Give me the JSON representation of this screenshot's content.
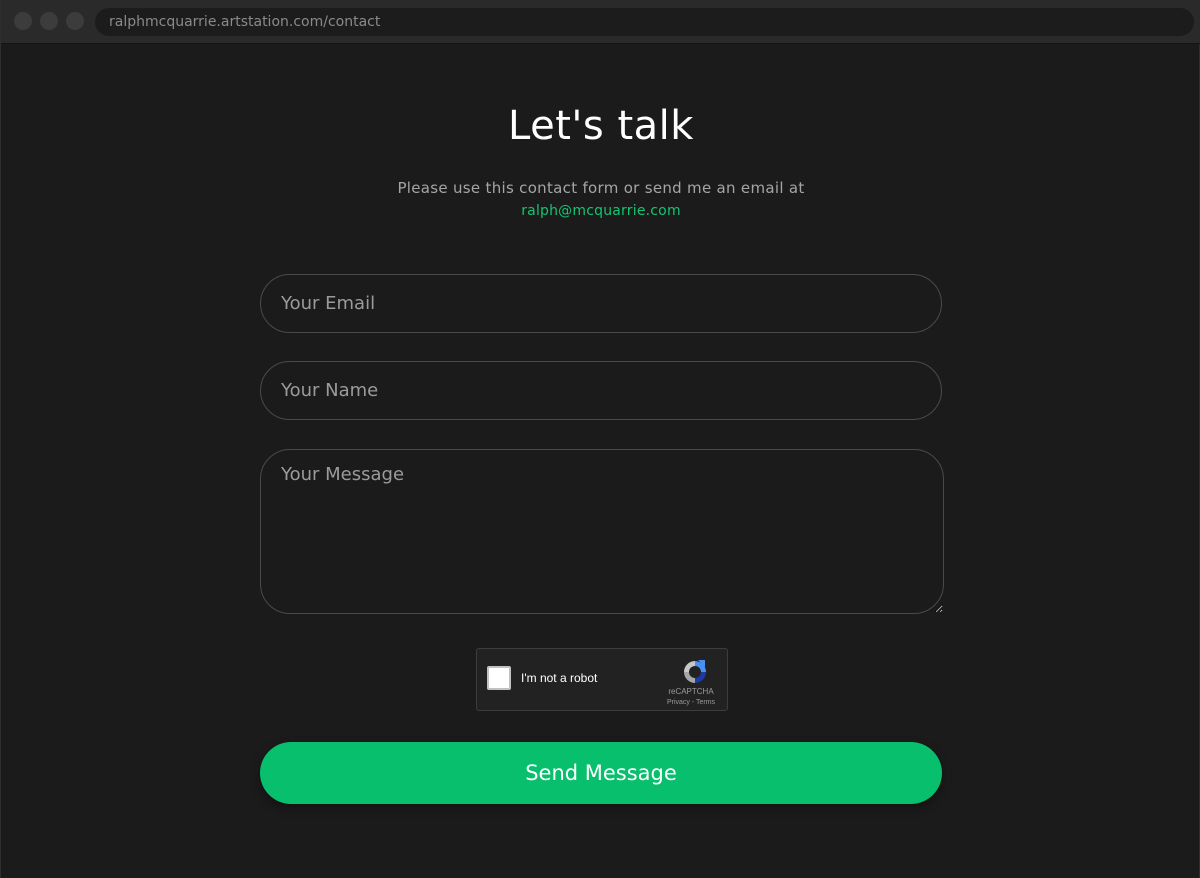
{
  "browser": {
    "url": "ralphmcquarrie.artstation.com/contact"
  },
  "page": {
    "title": "Let's talk",
    "subtitle": "Please use this contact form or send me an email at",
    "email": "ralph@mcquarrie.com"
  },
  "form": {
    "email_placeholder": "Your Email",
    "name_placeholder": "Your Name",
    "message_placeholder": "Your Message",
    "submit_label": "Send Message"
  },
  "recaptcha": {
    "label": "I'm not a robot",
    "brand": "reCAPTCHA",
    "links": "Privacy - Terms",
    "icon": "recaptcha-logo-icon"
  },
  "colors": {
    "background": "#1b1b1b",
    "accent": "#08bf6d",
    "link": "#13c571"
  }
}
